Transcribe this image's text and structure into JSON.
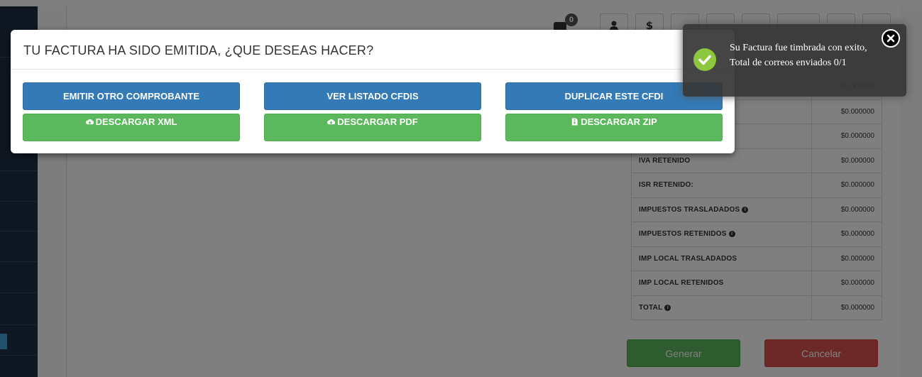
{
  "toolbar": {
    "chat_badge": "0",
    "dollar_label": "$",
    "icons": [
      "user-icon",
      "dollar-icon",
      "table-icon",
      "cloud-icon",
      "clock-icon",
      "wrench-icon",
      "gear-icon",
      "logout-icon"
    ]
  },
  "modal": {
    "title": "TU FACTURA HA SIDO EMITIDA, ¿QUE DESEAS HACER?",
    "emit_label": "EMITIR OTRO COMPROBANTE",
    "list_label": "VER LISTADO CFDIS",
    "duplicate_label": "DUPLICAR ESTE CFDI",
    "xml_label": "DESCARGAR XML",
    "pdf_label": "DESCARGAR PDF",
    "zip_label": "DESCARGAR ZIP"
  },
  "toast": {
    "line1": "Su Factura fue timbrada con exito,",
    "line2": "Total de correos enviados 0/1"
  },
  "summary": {
    "rows": [
      {
        "label": "",
        "amount": "$0.000000",
        "info": false
      },
      {
        "label": "",
        "amount": "$0.000000",
        "info": false
      },
      {
        "label": "",
        "amount": "$0.000000",
        "info": false
      },
      {
        "label": "IVA RETENIDO",
        "amount": "$0.000000",
        "info": false
      },
      {
        "label": "ISR RETENIDO:",
        "amount": "$0.000000",
        "info": false
      },
      {
        "label": "IMPUESTOS TRASLADADOS",
        "amount": "$0.000000",
        "info": true
      },
      {
        "label": "IMPUESTOS RETENIDOS",
        "amount": "$0.000000",
        "info": true
      },
      {
        "label": "IMP LOCAL TRASLADADOS",
        "amount": "$0.000000",
        "info": false
      },
      {
        "label": "IMP LOCAL RETENIDOS",
        "amount": "$0.000000",
        "info": false
      },
      {
        "label": "TOTAL",
        "amount": "$0.000000",
        "info": true
      }
    ]
  },
  "actions": {
    "generar_label": "Generar",
    "cancelar_label": "Cancelar"
  },
  "colors": {
    "primary_blue": "#337ab7",
    "success_green": "#5cb85c",
    "danger_red": "#d9534f",
    "toast_check": "#8dc63f"
  }
}
